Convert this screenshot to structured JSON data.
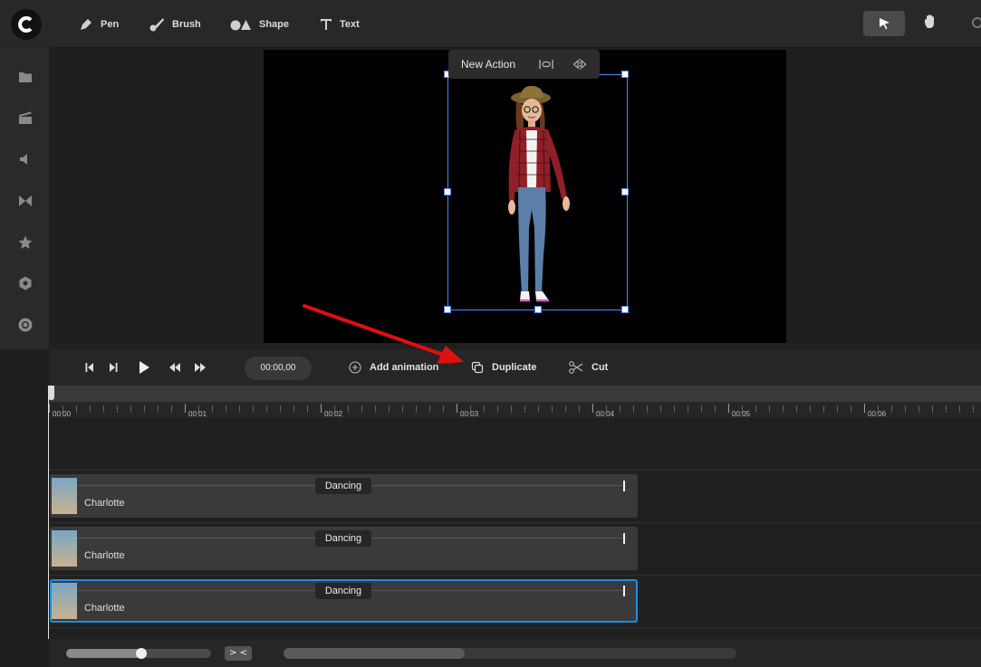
{
  "toolbar": {
    "logo_icon": "app-logo-icon",
    "tools": [
      {
        "label": "Pen",
        "icon": "pen-icon"
      },
      {
        "label": "Brush",
        "icon": "brush-icon"
      },
      {
        "label": "Shape",
        "icon": "shape-icon"
      },
      {
        "label": "Text",
        "icon": "text-icon"
      }
    ],
    "right_tools": [
      "select-arrow-icon",
      "hand-icon",
      "search-icon"
    ]
  },
  "sidebar": {
    "icons": [
      "folder-icon",
      "clapperboard-icon",
      "speaker-icon",
      "transition-icon",
      "star-icon",
      "hexagon-icon",
      "record-icon"
    ]
  },
  "canvas": {
    "action_popup": {
      "label": "New Action"
    }
  },
  "controls": {
    "time": "00:00,00",
    "add_animation": "Add animation",
    "duplicate": "Duplicate",
    "cut": "Cut"
  },
  "timeline": {
    "ticks": [
      "00:00",
      "00:01",
      "00:02",
      "00:03",
      "00:04",
      "00:05",
      "00:06"
    ],
    "tracks": [
      {
        "name": "Charlotte",
        "animation": "Dancing",
        "selected": false
      },
      {
        "name": "Charlotte",
        "animation": "Dancing",
        "selected": false
      },
      {
        "name": "Charlotte",
        "animation": "Dancing",
        "selected": true
      }
    ]
  },
  "bottom": {
    "zoom_level": 0.52,
    "collapse_label": "> <"
  },
  "colors": {
    "accent": "#1a8fe6",
    "selection": "#4f86ff",
    "annotation_arrow": "#e01010"
  }
}
